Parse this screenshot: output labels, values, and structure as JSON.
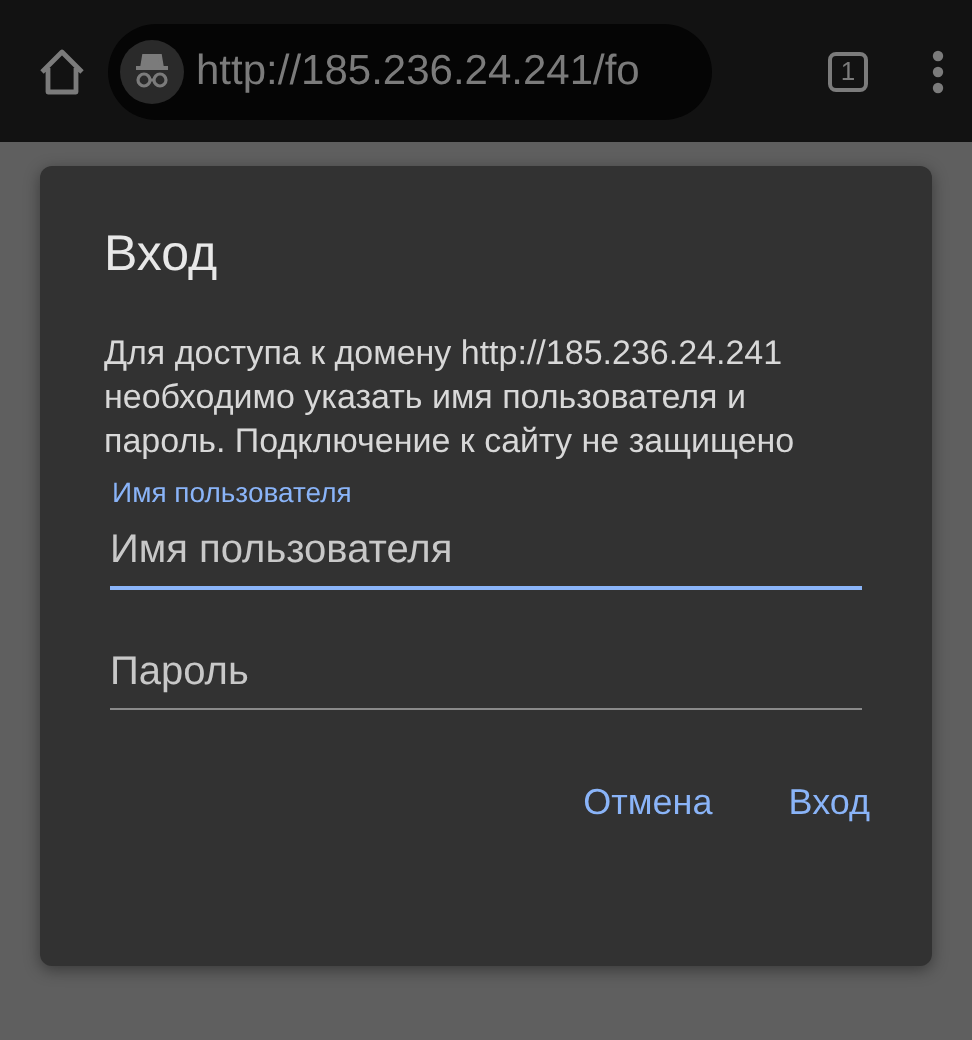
{
  "toolbar": {
    "url": "http://185.236.24.241/fo",
    "tab_count": "1"
  },
  "dialog": {
    "title": "Вход",
    "message": "Для доступа к домену http://185.236.24.241 необходимо указать имя пользователя и пароль. Подключение к сайту не защищено",
    "fields": [
      {
        "label": "Имя пользователя",
        "placeholder": "Имя пользователя",
        "focused": true
      },
      {
        "placeholder": "Пароль",
        "focused": false
      }
    ],
    "buttons": [
      "Отмена",
      "Вход"
    ]
  }
}
